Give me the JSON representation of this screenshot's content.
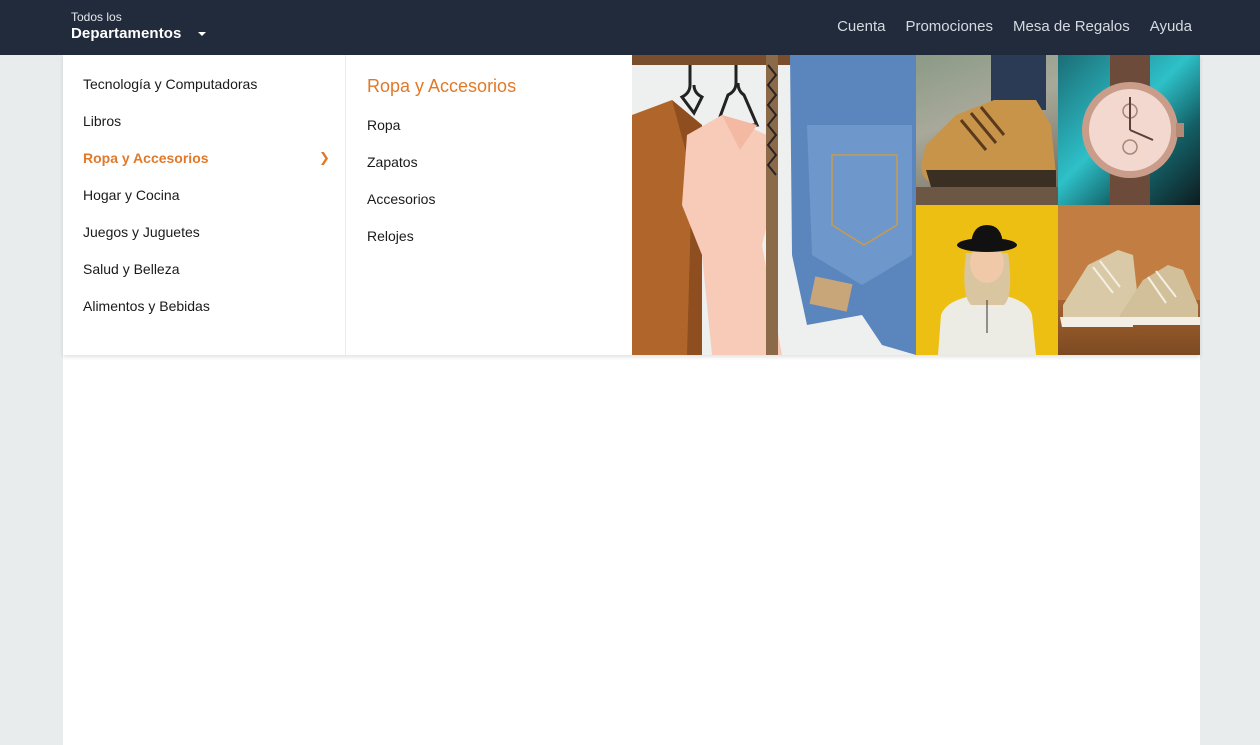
{
  "topbar": {
    "dept_small": "Todos los",
    "dept_big": "Departamentos",
    "nav": [
      "Cuenta",
      "Promociones",
      "Mesa de Regalos",
      "Ayuda"
    ]
  },
  "menu": {
    "categories": [
      "Tecnología y Computadoras",
      "Libros",
      "Ropa y Accesorios",
      "Hogar y Cocina",
      "Juegos y Juguetes",
      "Salud y Belleza",
      "Alimentos y Bebidas"
    ],
    "active_index": 2,
    "submenu_title": "Ropa y Accesorios",
    "submenu_items": [
      "Ropa",
      "Zapatos",
      "Accesorios",
      "Relojes"
    ]
  },
  "colors": {
    "topbar_bg": "#212b3b",
    "accent": "#e07a2a",
    "page_bg": "#e9ecec"
  },
  "icons": {
    "dropdown": "caret-down-icon",
    "active_chevron": "chevron-right-icon"
  }
}
